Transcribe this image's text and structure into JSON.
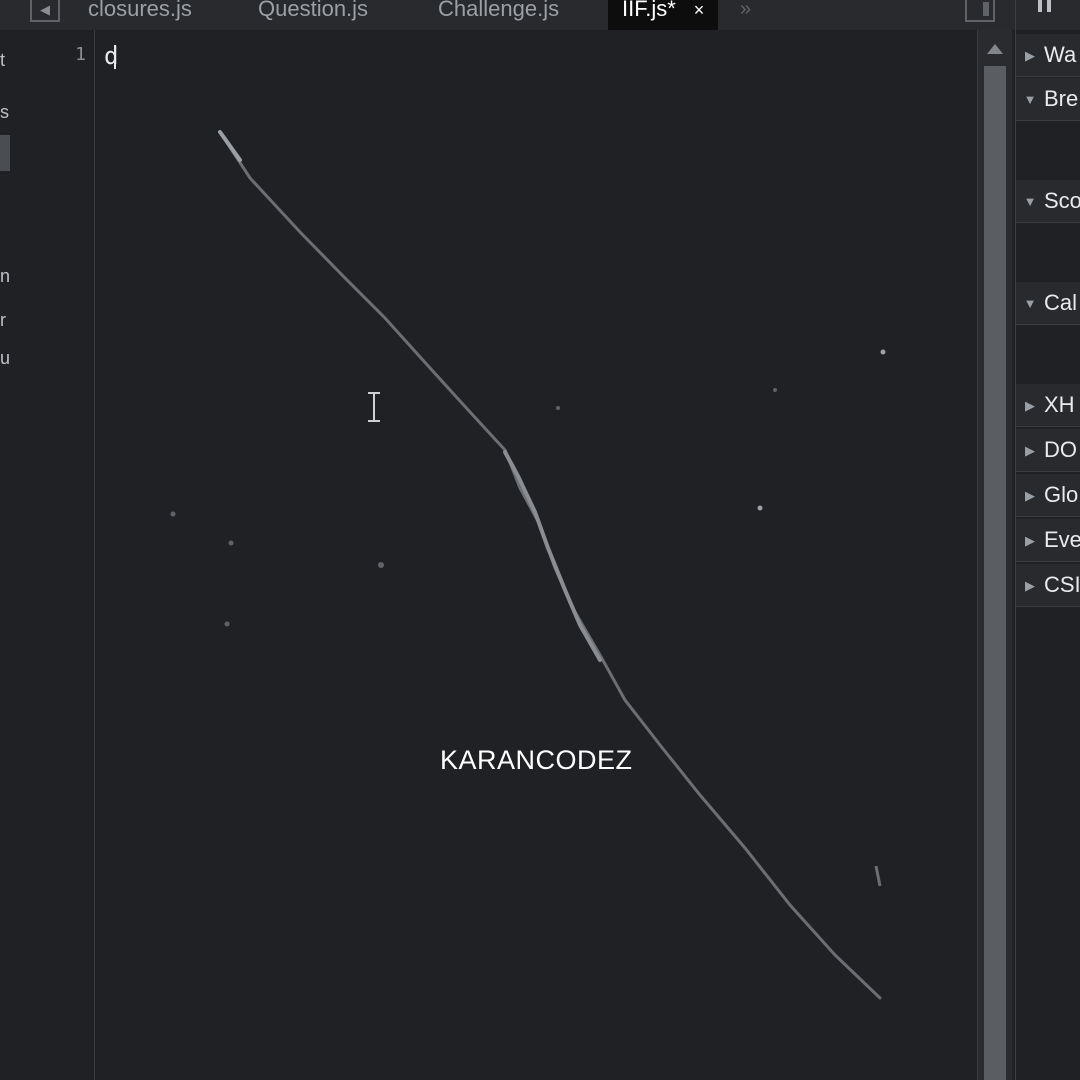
{
  "tabs": [
    {
      "label": "closures.js"
    },
    {
      "label": "Question.js"
    },
    {
      "label": "Challenge.js"
    },
    {
      "label": "IIF.js*",
      "close": "×"
    }
  ],
  "tab_overflow": "»",
  "navigator_fragments": [
    "t",
    "s",
    "n",
    "r",
    "u"
  ],
  "editor": {
    "line_number": "1",
    "line_text": "d"
  },
  "watermark": "KARANCODEZ",
  "debugger_panels": [
    {
      "label": "Wa",
      "expanded": false
    },
    {
      "label": "Bre",
      "expanded": true
    },
    {
      "label": "Sco",
      "expanded": true
    },
    {
      "label": "Cal",
      "expanded": true
    },
    {
      "label": "XH",
      "expanded": false
    },
    {
      "label": "DO",
      "expanded": false
    },
    {
      "label": "Glo",
      "expanded": false
    },
    {
      "label": "Eve",
      "expanded": false
    },
    {
      "label": "CSI",
      "expanded": false
    }
  ],
  "colors": {
    "editor_bg": "#202124",
    "active_tab_bg": "#0d0d0e",
    "text": "#e8eaed"
  }
}
